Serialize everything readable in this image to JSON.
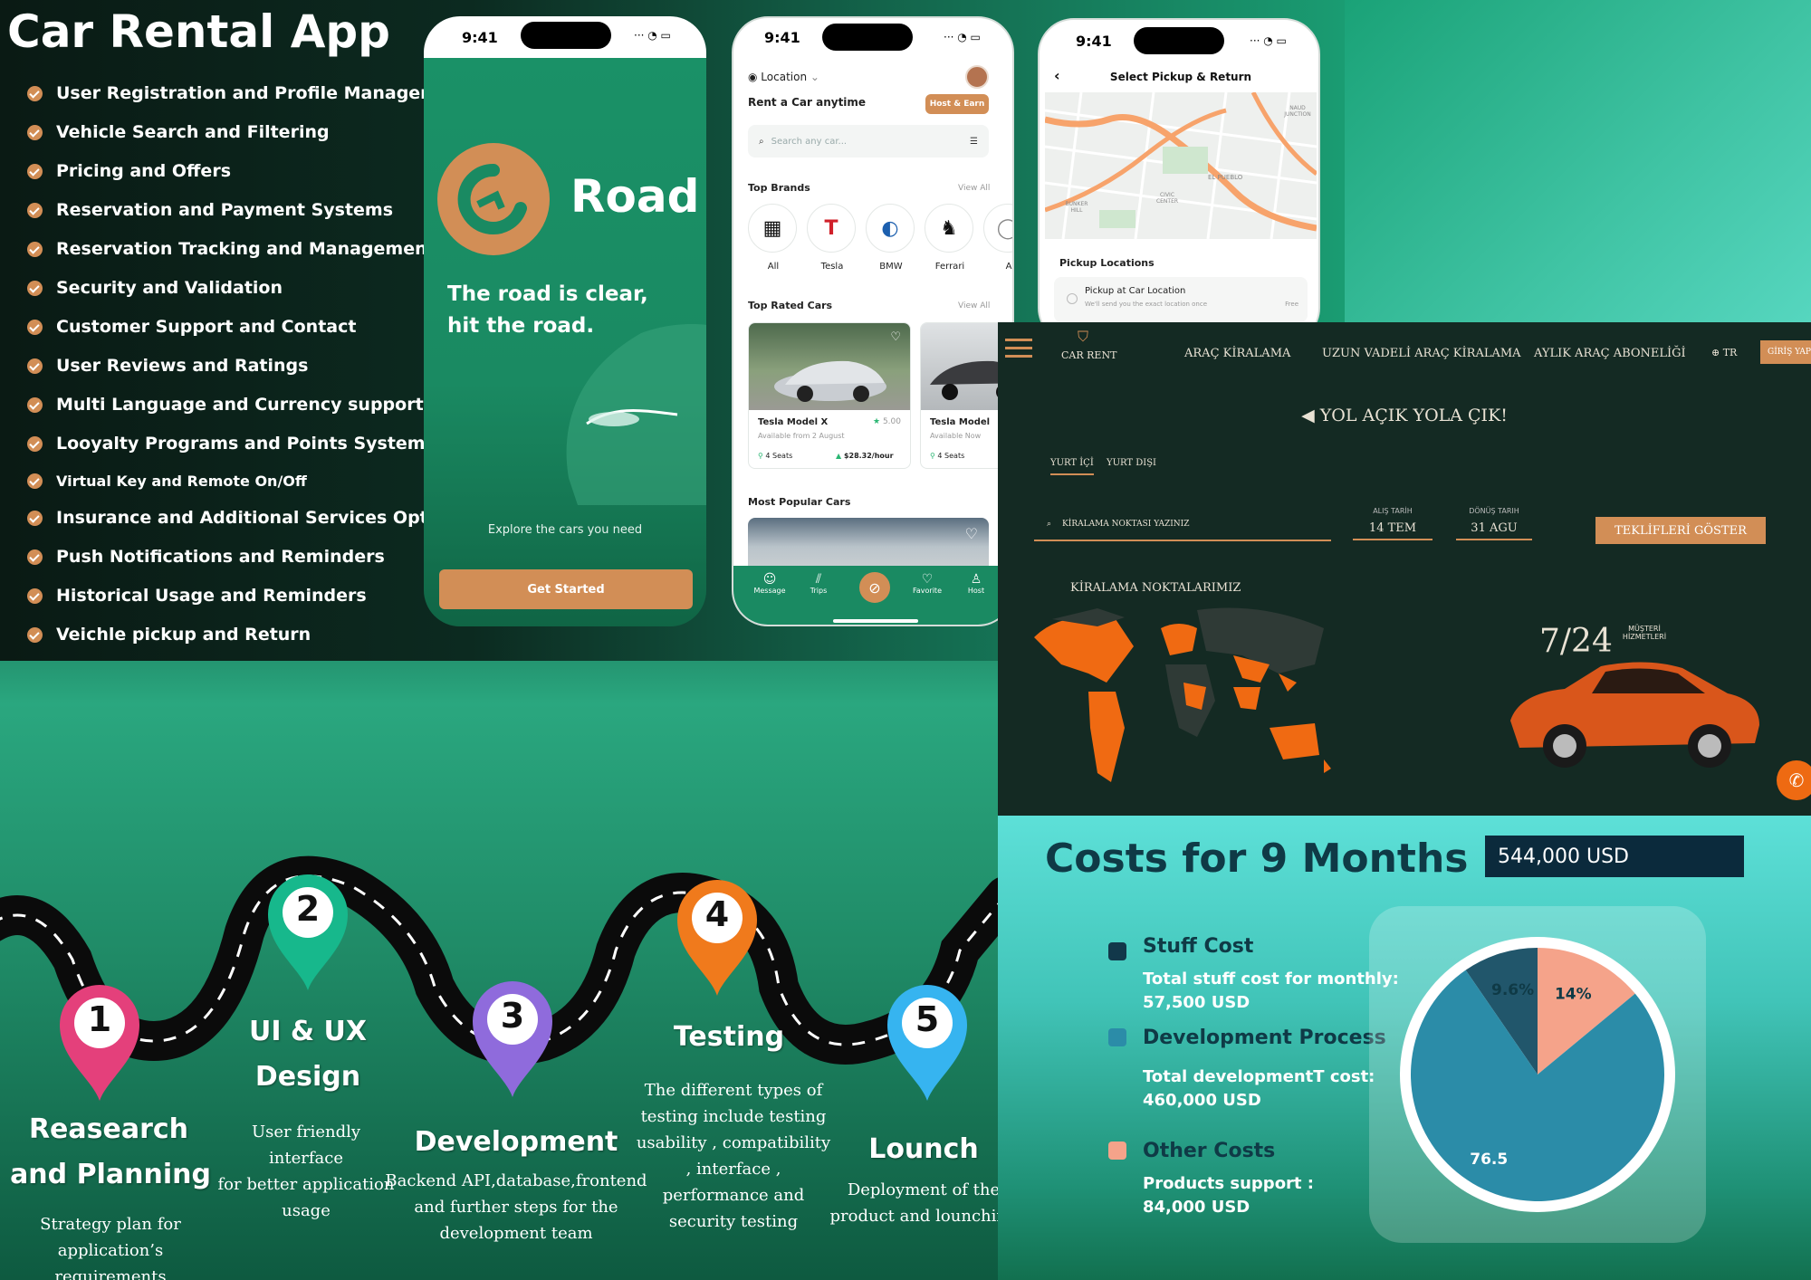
{
  "header": {
    "title": "Car Rental App"
  },
  "features": [
    "User Registration and Profile Management",
    "Vehicle Search and Filtering",
    "Pricing and Offers",
    "Reservation and Payment Systems",
    "Reservation Tracking and Management",
    "Security and Validation",
    "Customer Support and Contact",
    "User Reviews and Ratings",
    "Multi Language and Currency support",
    "Looyalty Programs and Points System",
    "Virtual Key and Remote On/Off",
    "Insurance and Additional Services Options",
    "Push Notifications and Reminders",
    "Historical Usage and Reminders",
    "Veichle pickup and Return"
  ],
  "colors": {
    "accent": "#d28e56",
    "brand_green": "#1b8a63",
    "dark": "#142a23",
    "navy": "#0b2a3c",
    "orange_map": "#f06a12"
  },
  "phone1": {
    "time": "9:41",
    "brand": "Road",
    "tagline_1": "The road is clear,",
    "tagline_2": "hit the road.",
    "explore": "Explore the cars you need",
    "cta": "Get Started"
  },
  "phone2": {
    "time": "9:41",
    "location": "Location",
    "subtitle": "Rent a Car anytime",
    "host_btn": "Host & Earn",
    "search_placeholder": "Search any car...",
    "top_brands": "Top Brands",
    "view_all": "View All",
    "brands": [
      {
        "label": "All",
        "icon": "grid-icon"
      },
      {
        "label": "Tesla",
        "icon": "tesla-logo"
      },
      {
        "label": "BMW",
        "icon": "bmw-logo"
      },
      {
        "label": "Ferrari",
        "icon": "ferrari-logo"
      },
      {
        "label": "A",
        "icon": "brand-logo"
      }
    ],
    "top_rated": "Top Rated Cars",
    "cars": [
      {
        "name": "Tesla Model X",
        "rating": "5.00",
        "avail": "Available from 2 August",
        "seats": "4 Seats",
        "price": "$28.32/hour"
      },
      {
        "name": "Tesla Model",
        "avail": "Available Now",
        "seats": "4 Seats"
      }
    ],
    "most_popular": "Most Popular Cars",
    "tabs": [
      "Message",
      "Trips",
      "",
      "Favorite",
      "Host"
    ]
  },
  "phone3": {
    "time": "9:41",
    "title": "Select Pickup & Return",
    "pickup_locations": "Pickup Locations",
    "option_title": "Pickup at Car Location",
    "option_desc": "We'll send you the exact location once",
    "option_price": "Free",
    "map_labels": [
      "NAUD JUNCTION",
      "EL PUEBLO",
      "CIVIC CENTER",
      "BUNKER HILL"
    ]
  },
  "web": {
    "logo": "CAR RENT",
    "nav": [
      "ARAÇ KİRALAMA",
      "UZUN VADELİ ARAÇ KİRALAMA",
      "AYLIK ARAÇ ABONELİĞİ"
    ],
    "lang": "TR",
    "login": "GİRİŞ YAP",
    "hero": "YOL AÇIK YOLA ÇIK!",
    "tab1": "YURT İÇİ",
    "tab2": "YURT DIŞI",
    "search_placeholder": "KİRALAMA NOKTASI YAZINIZ",
    "pickup_label": "ALIŞ TARİH",
    "pickup_val": "14 TEM",
    "return_label": "DÖNÜŞ TARIH",
    "return_val": "31 AGU",
    "cta": "TEKLİFLERİ GÖSTER",
    "points": "KİRALAMA NOKTALARIMIZ",
    "support_big": "7/24",
    "support_small1": "MÜŞTERİ",
    "support_small2": "HİZMETLERİ"
  },
  "roadmap": {
    "steps": [
      {
        "num": "1",
        "title1": "Reasearch",
        "title2": "and Planning",
        "desc": [
          "Strategy plan for",
          "application’s requirements"
        ],
        "color": "#e4407b"
      },
      {
        "num": "2",
        "title1": "UI & UX",
        "title2": "Design",
        "desc": [
          "User friendly interface",
          "for better application",
          "usage"
        ],
        "color": "#17b88c"
      },
      {
        "num": "3",
        "title1": "Development",
        "title2": "",
        "desc": [
          "Backend API,database,frontend",
          "and  further steps for the",
          "development team"
        ],
        "color": "#8f6bdc"
      },
      {
        "num": "4",
        "title1": "Testing",
        "title2": "",
        "desc": [
          "The different types of",
          "testing include testing",
          "usability , compatibility",
          ", interface ,",
          "performance and",
          "security testing"
        ],
        "color": "#f07a1c"
      },
      {
        "num": "5",
        "title1": "Lounch",
        "title2": "",
        "desc": [
          "Deployment of the",
          "product and lounching"
        ],
        "color": "#36b4f0"
      }
    ]
  },
  "costs": {
    "title": "Costs for 9 Months",
    "total": "544,000 USD",
    "legend": [
      {
        "title": "Stuff Cost",
        "line1": "Total stuff cost for monthly:",
        "line2": "57,500 USD",
        "color": "#12384a"
      },
      {
        "title": "Development Process",
        "line1": "Total developmentT cost:",
        "line2": "460,000 USD",
        "color": "#2b8ca8"
      },
      {
        "title": "Other Costs",
        "line1": "Products support :",
        "line2": "84,000 USD",
        "color": "#f5a38a"
      }
    ]
  },
  "chart_data": {
    "type": "pie",
    "labels": [
      "9.6%",
      "14%",
      "76.5"
    ],
    "values": [
      9.6,
      14,
      76.5
    ],
    "colors": [
      "#21566b",
      "#f5a38a",
      "#2b8ca8"
    ]
  }
}
